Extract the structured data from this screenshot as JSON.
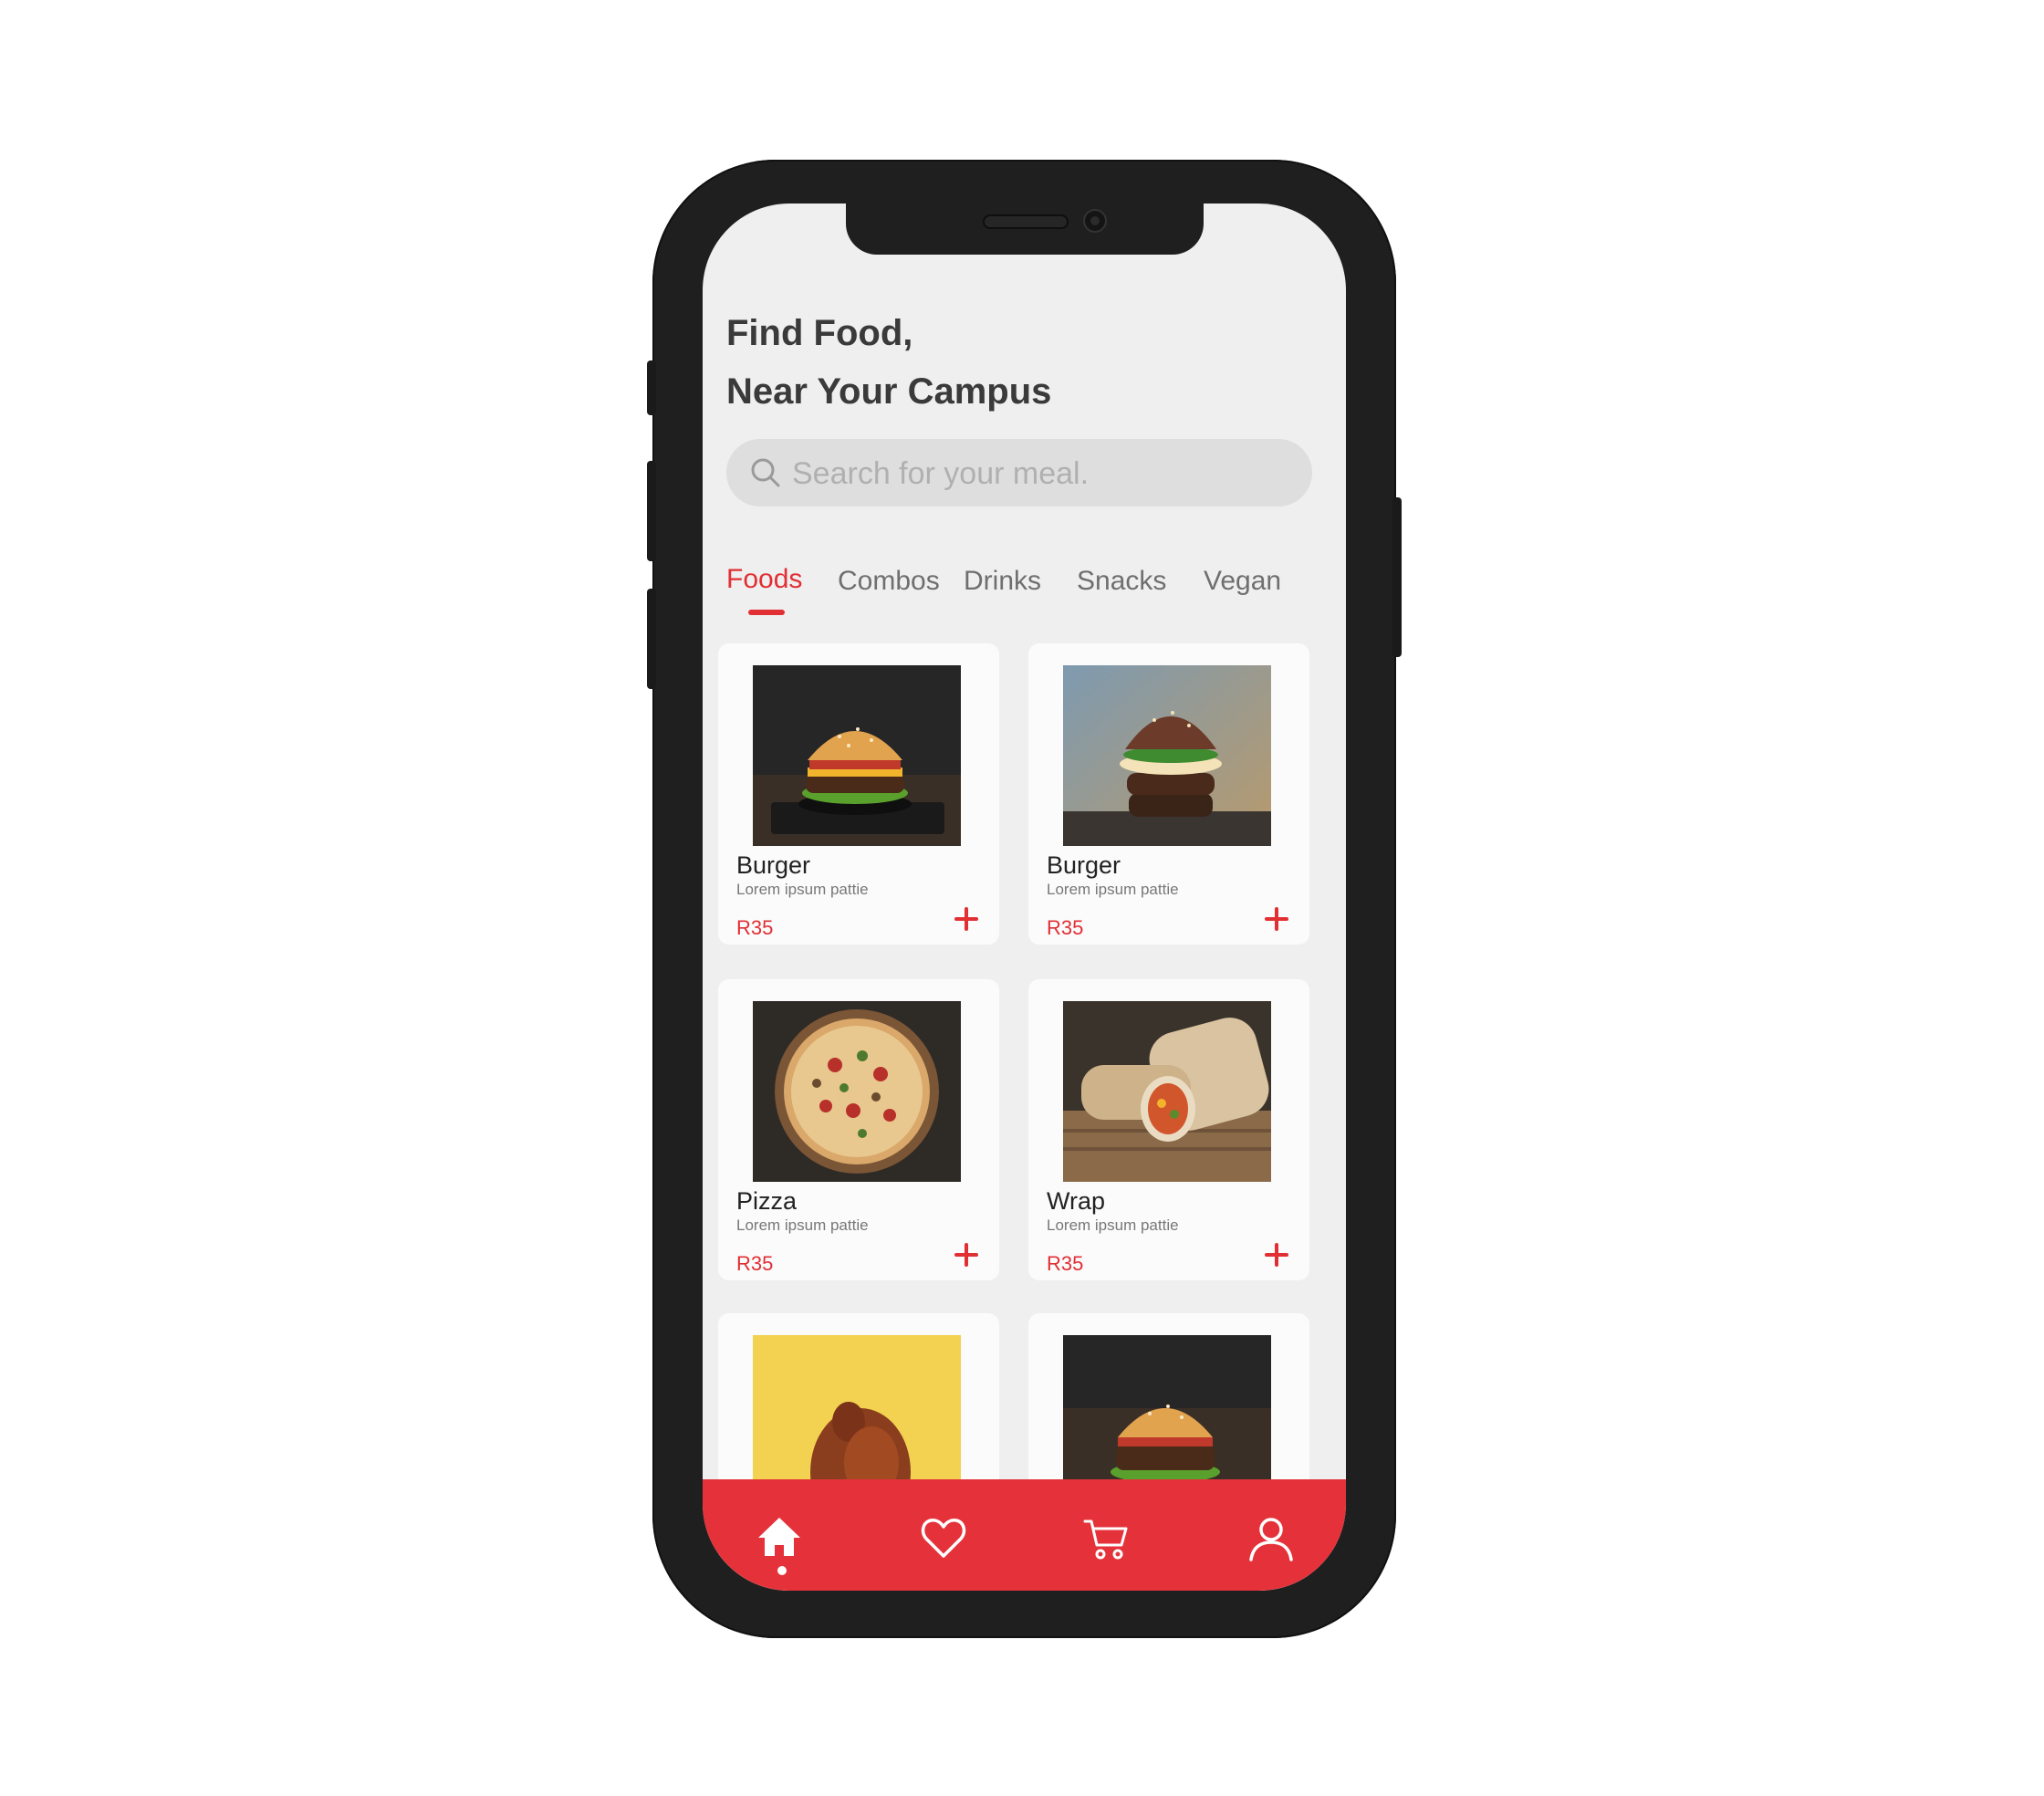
{
  "header": {
    "line1": "Find Food,",
    "line2": "Near Your Campus"
  },
  "search": {
    "placeholder": "Search for your meal."
  },
  "tabs": [
    {
      "label": "Foods",
      "active": true
    },
    {
      "label": "Combos",
      "active": false
    },
    {
      "label": "Drinks",
      "active": false
    },
    {
      "label": "Snacks",
      "active": false
    },
    {
      "label": "Vegan",
      "active": false
    }
  ],
  "products": [
    {
      "name": "Burger",
      "desc": "Lorem ipsum pattie",
      "price": "R35",
      "image": "burger-on-dark-plate"
    },
    {
      "name": "Burger",
      "desc": "Lorem ipsum pattie",
      "price": "R35",
      "image": "double-burger-with-egg"
    },
    {
      "name": "Pizza",
      "desc": "Lorem ipsum pattie",
      "price": "R35",
      "image": "pizza-top-view"
    },
    {
      "name": "Wrap",
      "desc": "Lorem ipsum pattie",
      "price": "R35",
      "image": "wraps-on-wood"
    },
    {
      "name": "",
      "desc": "",
      "price": "",
      "image": "roast-chicken-yellow-background"
    },
    {
      "name": "",
      "desc": "",
      "price": "",
      "image": "burger-on-dark-plate"
    }
  ],
  "bottom_nav": [
    {
      "icon": "home-icon",
      "active": true
    },
    {
      "icon": "heart-icon",
      "active": false
    },
    {
      "icon": "cart-icon",
      "active": false
    },
    {
      "icon": "user-icon",
      "active": false
    }
  ],
  "colors": {
    "accent": "#e5323a",
    "background": "#efefef",
    "card": "#fbfbfb",
    "heading": "#3a3a3a"
  }
}
